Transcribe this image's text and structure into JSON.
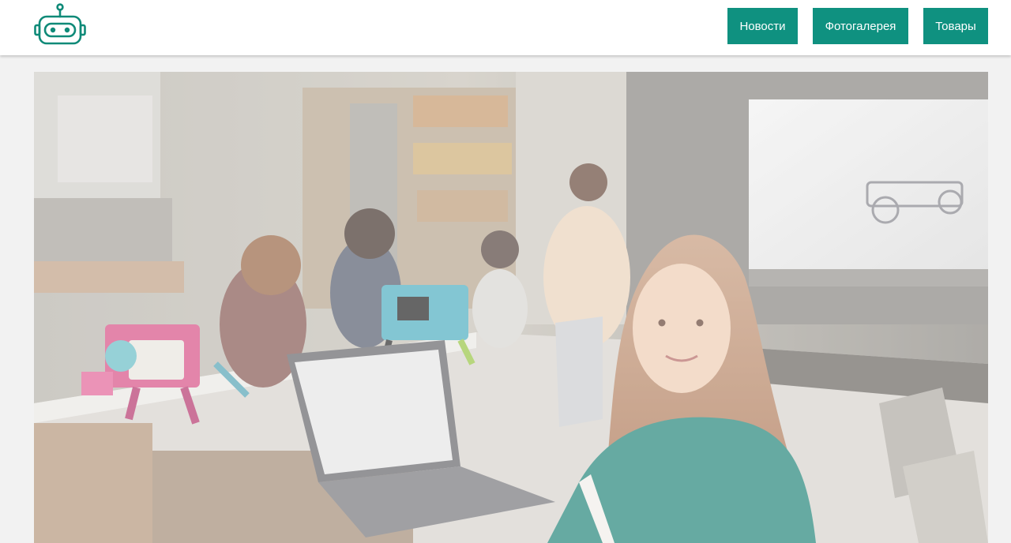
{
  "header": {
    "logo_icon": "robot-head-icon",
    "nav": [
      {
        "label": "Новости"
      },
      {
        "label": "Фотогалерея"
      },
      {
        "label": "Товары"
      }
    ]
  },
  "hero": {
    "image_subject": "classroom-robotics-photo"
  },
  "colors": {
    "accent": "#0f9180",
    "header_bg": "#ffffff",
    "page_bg": "#f2f2f2"
  }
}
